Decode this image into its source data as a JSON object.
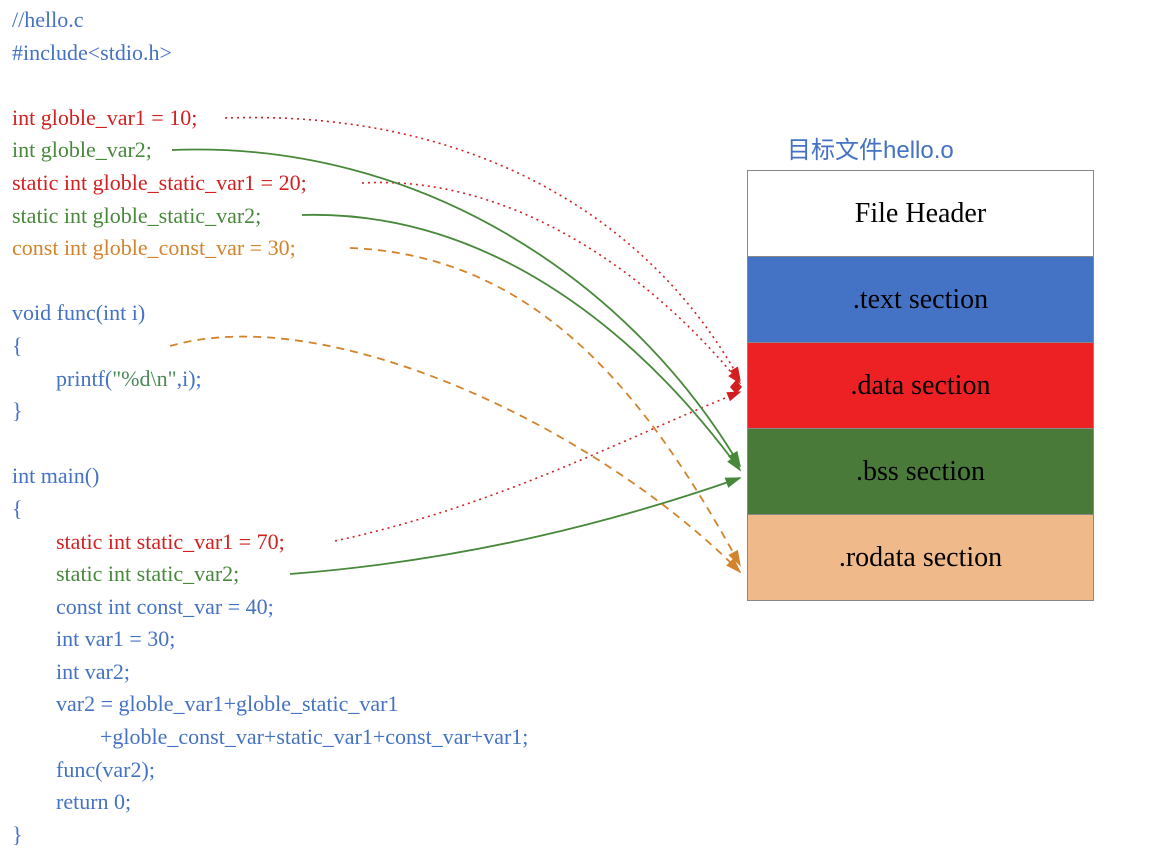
{
  "code": {
    "l1": "//hello.c",
    "l2": "#include<stdio.h>",
    "l3": "int globle_var1 = 10;",
    "l4": "int globle_var2;",
    "l5": "static int globle_static_var1 = 20;",
    "l6": "static int globle_static_var2;",
    "l7": "const int globle_const_var = 30;",
    "l8": "void func(int i)",
    "l9": "{",
    "l10a": "        printf(",
    "l10b": "\"%d\\n\"",
    "l10c": ",i);",
    "l11": "}",
    "l12": "int main()",
    "l13": "{",
    "l14": "        static int static_var1 = 70;",
    "l15": "        static int static_var2;",
    "l16": "        const int const_var = 40;",
    "l17": "        int var1 = 30;",
    "l18": "        int var2;",
    "l19": "        var2 = globle_var1+globle_static_var1",
    "l20": "                +globle_const_var+static_var1+const_var+var1;",
    "l21": "        func(var2);",
    "l22": "        return 0;",
    "l23": "}"
  },
  "object_file": {
    "title": "目标文件hello.o",
    "sections": {
      "header": "File Header",
      "text": ".text section",
      "data": ".data section",
      "bss": ".bss section",
      "rodata": ".rodata section"
    }
  },
  "arrows": [
    {
      "from": "globle_var1",
      "to": "data",
      "style": "dotted-red"
    },
    {
      "from": "globle_var2",
      "to": "bss",
      "style": "solid-green"
    },
    {
      "from": "globle_static_var1",
      "to": "data",
      "style": "dotted-red"
    },
    {
      "from": "globle_static_var2",
      "to": "bss",
      "style": "solid-green"
    },
    {
      "from": "globle_const_var",
      "to": "rodata",
      "style": "dashed-orange"
    },
    {
      "from": "printf-string",
      "to": "rodata",
      "style": "dashed-orange"
    },
    {
      "from": "static_var1",
      "to": "data",
      "style": "dotted-red"
    },
    {
      "from": "static_var2",
      "to": "bss",
      "style": "solid-green"
    }
  ],
  "colors": {
    "blue": "#4472c4",
    "red": "#d31f1f",
    "green": "#47883a",
    "orange": "#d3832b",
    "section_text": "#4472c4",
    "section_data": "#ed2024",
    "section_bss": "#4a7a3a",
    "section_rodata": "#f0b98a"
  }
}
